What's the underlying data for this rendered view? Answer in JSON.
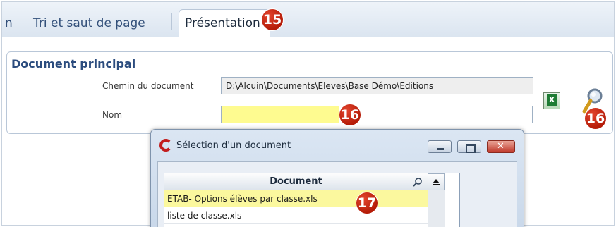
{
  "tabs": {
    "prev_fragment": "n",
    "sort_label": "Tri et saut de page",
    "active_label": "Présentation",
    "active_badge": "15"
  },
  "main_document": {
    "title": "Document principal",
    "path_label": "Chemin du document",
    "path_value": "D:\\Alcuin\\Documents\\Eleves\\Base Démo\\Editions",
    "name_label": "Nom",
    "name_value": "",
    "name_badge": "16",
    "search_badge": "16",
    "excel_icon": "excel-icon",
    "search_icon": "magnifier-icon"
  },
  "dialog": {
    "title": "Sélection d'un document",
    "column_header": "Document",
    "rows": [
      "ETAB- Options élèves par classe.xls",
      "liste de classe.xls"
    ],
    "row_badge": "17"
  },
  "colors": {
    "highlight_yellow": "#fefb90",
    "badge_red": "#c8230c",
    "title_blue": "#2b4c7e"
  }
}
